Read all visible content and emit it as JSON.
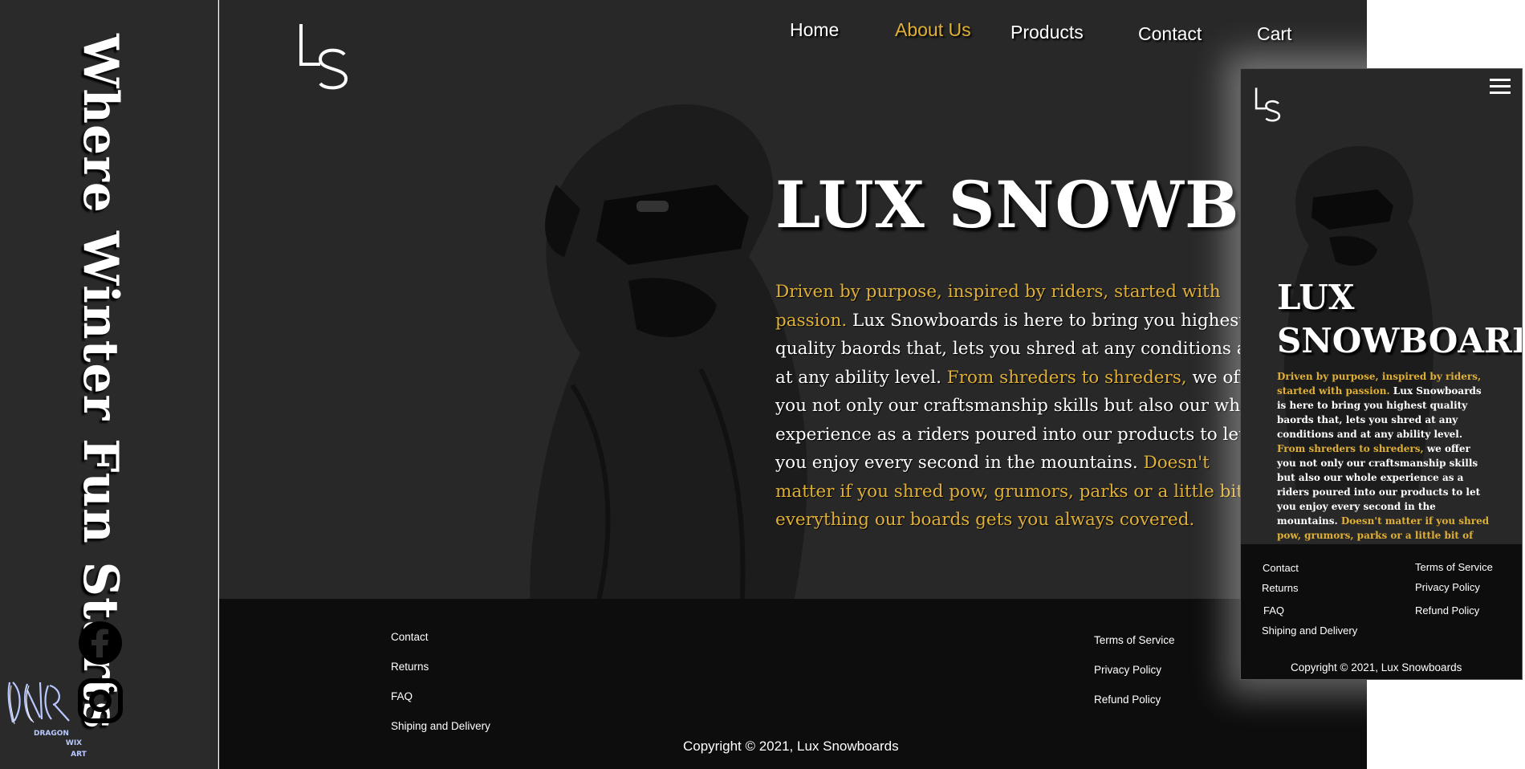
{
  "rail": {
    "tagline": "Where Winter Fun Starts",
    "social": [
      "facebook-icon",
      "instagram-icon"
    ],
    "artist_logo_text": [
      "DRAGON",
      "WIX",
      "ART"
    ]
  },
  "brand": {
    "logo": "LS",
    "name": "LUX SNOWBOARDS"
  },
  "nav": {
    "home": "Home",
    "about": "About Us",
    "products": "Products",
    "contact": "Contact",
    "cart": "Cart",
    "active": "About Us"
  },
  "hero": {
    "title": "LUX SNOWBOARDS",
    "p1_highlight": "Driven by purpose, inspired by riders, started with passion.",
    "p1_text": " Lux Snowboards is here to bring you highest quality baords that, lets you shred at any conditions and at any ability level. ",
    "p2_highlight": "From shreders to shreders,",
    "p2_text": " we offer you not only our craftsmanship skills but also our whole experience as a riders poured into our products to let you enjoy every second in the mountains. ",
    "p3_highlight": "Doesn't matter if you shred pow, grumors, parks or a little bit of everything our boards gets you always covered."
  },
  "footer": {
    "left": [
      "Contact",
      "Returns",
      "FAQ",
      "Shiping and Delivery"
    ],
    "right": [
      "Terms of Service",
      "Privacy Policy",
      "Refund Policy"
    ],
    "copyright": "Copyright © 2021, Lux Snowboards"
  },
  "mobile": {
    "title_line1": "LUX",
    "title_line2": "SNOWBOARDS",
    "menu_icon": "hamburger-menu-icon"
  },
  "colors": {
    "accent": "#e0b036",
    "background": "#282828",
    "footer": "#0d0d0d",
    "text": "#ffffff"
  }
}
